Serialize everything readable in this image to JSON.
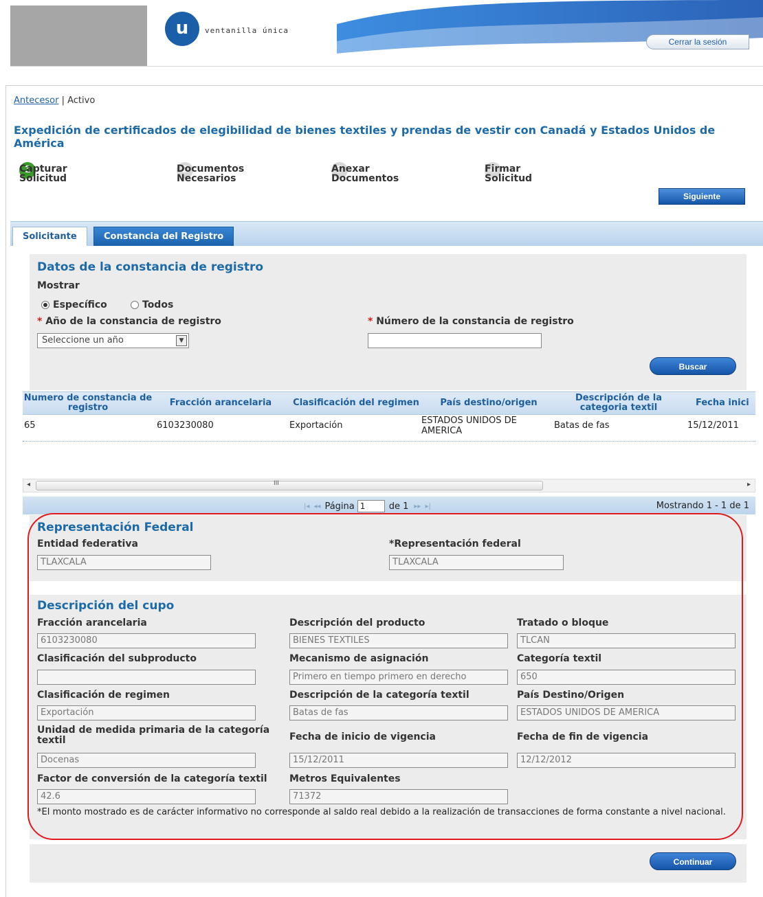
{
  "header": {
    "logo_letter": "u",
    "logo_text": "ventanilla única",
    "logout": "Cerrar la sesión",
    "colors": {
      "accent": "#1d6aa8",
      "brand_blue": "#1b5fa8",
      "active_step": "#3a9b2a",
      "highlight": "#e0191f"
    }
  },
  "breadcrumb": {
    "link": "Antecesor",
    "separator": "|",
    "current": "Activo"
  },
  "title": "Expedición de certificados de elegibilidad de bienes textiles y prendas de vestir con Canadá y Estados Unidos de América",
  "steps": [
    {
      "num": "1",
      "label": "Capturar Solicitud",
      "active": true
    },
    {
      "num": "2",
      "label": "Documentos Necesarios",
      "active": false
    },
    {
      "num": "3",
      "label": "Anexar Documentos",
      "active": false
    },
    {
      "num": "4",
      "label": "Firmar Solicitud",
      "active": false
    }
  ],
  "next_button": "Siguiente",
  "tabs": [
    {
      "label": "Solicitante"
    },
    {
      "label": "Constancia del Registro"
    }
  ],
  "search": {
    "title": "Datos de la constancia de registro",
    "mostrar": "Mostrar",
    "radio_specific": "Específico",
    "radio_all": "Todos",
    "year_label": "Año de la constancia de registro",
    "year_value": "Seleccione un año",
    "number_label": "Número de la constancia de registro",
    "number_value": "",
    "required_mark": "*",
    "button": "Buscar"
  },
  "table": {
    "headers": [
      "Numero de constancia de registro",
      "Fracción arancelaria",
      "Clasificación del regimen",
      "País destino/origen",
      "Descripción de la categoria textil",
      "Fecha inici"
    ],
    "rows": [
      [
        "65",
        "6103230080",
        "Exportación",
        "ESTADOS UNIDOS DE AMERICA",
        "Batas de fas",
        "15/12/2011"
      ]
    ]
  },
  "pager": {
    "page_label": "Página",
    "page_value": "1",
    "of_label": "de 1",
    "showing": "Mostrando 1 - 1 de 1"
  },
  "federal": {
    "title": "Representación Federal",
    "entidad_label": "Entidad federativa",
    "entidad_value": "TLAXCALA",
    "rep_label": "*Representación federal",
    "rep_value": "TLAXCALA"
  },
  "cupo": {
    "title": "Descripción del cupo",
    "fields": [
      {
        "label": "Fracción arancelaria",
        "value": "6103230080"
      },
      {
        "label": "Descripción del producto",
        "value": "BIENES TEXTILES"
      },
      {
        "label": "Tratado o bloque",
        "value": "TLCAN"
      },
      {
        "label": "Clasificación del subproducto",
        "value": ""
      },
      {
        "label": "Mecanismo de asignación",
        "value": "Primero en tiempo primero en derecho"
      },
      {
        "label": "Categoría textil",
        "value": "650"
      },
      {
        "label": "Clasificación de regimen",
        "value": "Exportación"
      },
      {
        "label": "Descripción de la categoría textil",
        "value": "Batas de fas"
      },
      {
        "label": "País Destino/Origen",
        "value": "ESTADOS UNIDOS DE AMERICA"
      },
      {
        "label": "Unidad de medida primaria de la categoría textil",
        "value": "Docenas"
      },
      {
        "label": "Fecha de inicio de vigencia",
        "value": "15/12/2011"
      },
      {
        "label": "Fecha de fin de vigencia",
        "value": "12/12/2012"
      },
      {
        "label": "Factor de conversión de la categoría textil",
        "value": "42.6"
      },
      {
        "label": "Metros Equivalentes",
        "value": "71372"
      }
    ],
    "note": "*El monto mostrado es de carácter informativo no corresponde al saldo real debido a la realización de transacciones de forma constante a nivel nacional."
  },
  "continue_button": "Continuar"
}
